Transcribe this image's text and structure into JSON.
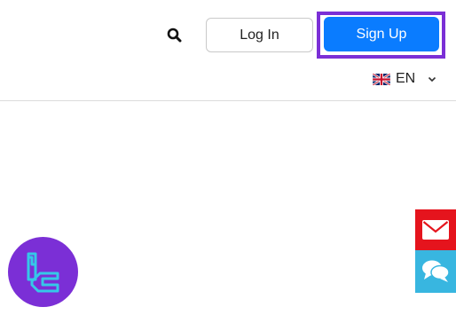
{
  "header": {
    "search_icon": "search-icon",
    "login_label": "Log In",
    "signup_label": "Sign Up",
    "signup_highlight_color": "#7b2fd6",
    "signup_color": "#0a7cff",
    "language": {
      "flag_icon": "uk-flag-icon",
      "code": "EN",
      "chevron_icon": "chevron-down-icon"
    }
  },
  "floating_actions": {
    "mail": {
      "icon": "envelope-icon",
      "color": "#e5141d"
    },
    "chat": {
      "icon": "chat-bubbles-icon",
      "color": "#38b6e0"
    }
  },
  "logo_badge": {
    "icon": "brand-logo-icon",
    "color": "#7b2fd6",
    "accent": "#35c8e8"
  }
}
